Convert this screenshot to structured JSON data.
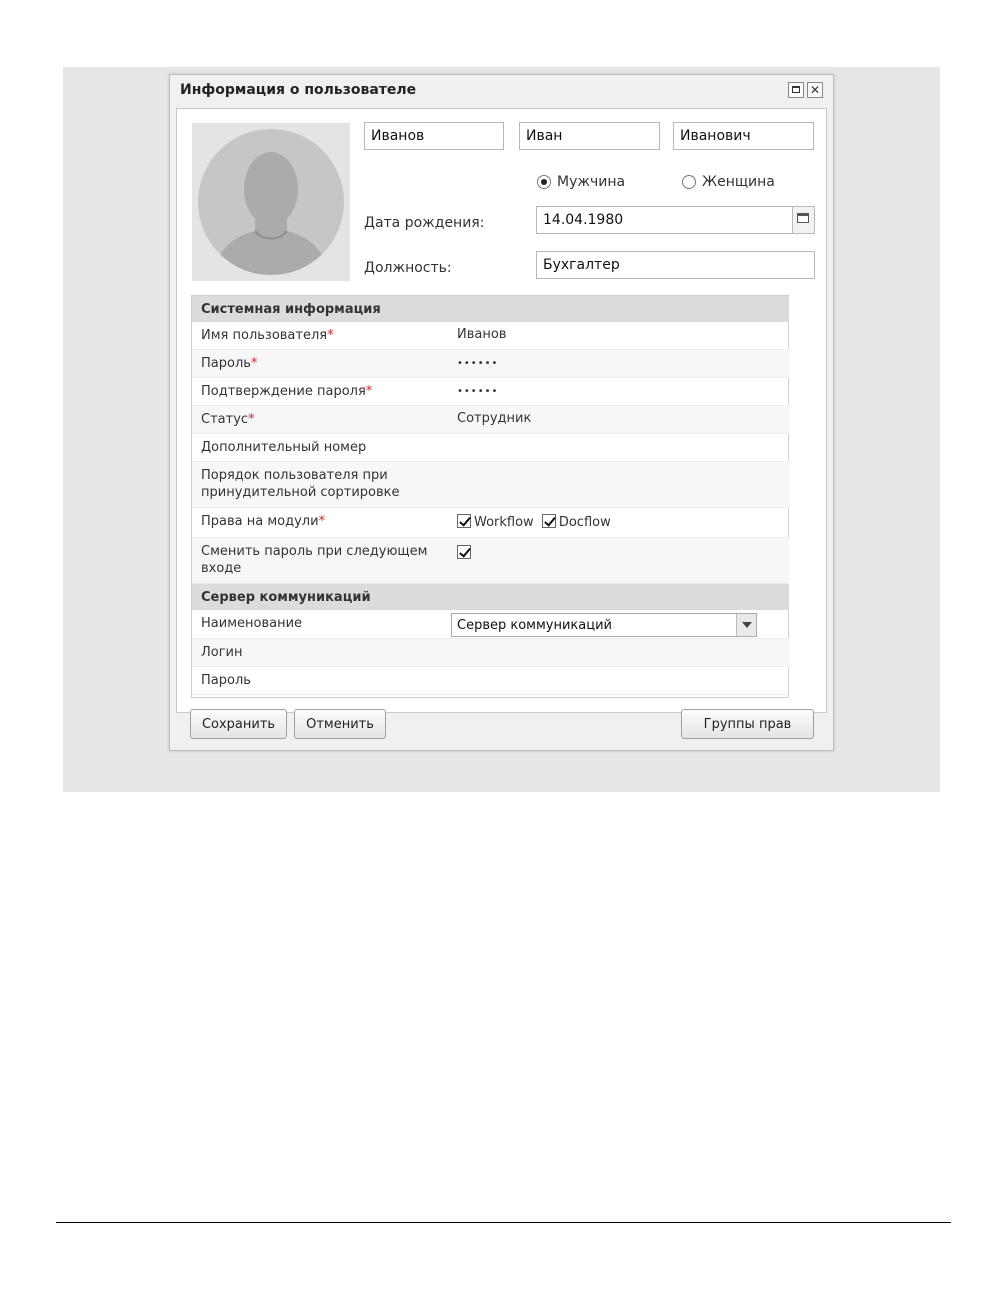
{
  "dialog": {
    "title": "Информация о пользователе",
    "maximize_icon": "maximize-icon",
    "close_icon": "close-icon"
  },
  "profile": {
    "last_name": "Иванов",
    "first_name": "Иван",
    "middle_name": "Иванович",
    "gender_options": [
      {
        "label": "Мужчина",
        "selected": true
      },
      {
        "label": "Женщина",
        "selected": false
      }
    ],
    "birth_date_label": "Дата рождения:",
    "birth_date": "14.04.1980",
    "position_label": "Должность:",
    "position": "Бухгалтер"
  },
  "system_info": {
    "header": "Системная информация",
    "username_label": "Имя пользователя",
    "username": "Иванов",
    "password_label": "Пароль",
    "password": "••••••",
    "confirm_label": "Подтверждение пароля",
    "confirm": "••••••",
    "status_label": "Статус",
    "status": "Сотрудник",
    "extra_number_label": "Дополнительный номер",
    "sort_order_label": "Порядок пользователя при принудительной сортировке",
    "modules_label": "Права на модули",
    "modules": [
      {
        "label": "Workflow",
        "checked": true
      },
      {
        "label": "Docflow",
        "checked": true
      }
    ],
    "change_password_label": "Сменить пароль при следующем входе",
    "change_password_checked": true,
    "required_mark": "*"
  },
  "comm_server": {
    "header": "Сервер коммуникаций",
    "name_label": "Наименование",
    "name_value": "Сервер коммуникаций",
    "login_label": "Логин",
    "password_label": "Пароль"
  },
  "buttons": {
    "save": "Сохранить",
    "cancel": "Отменить",
    "rights_groups": "Группы прав"
  },
  "colors": {
    "required": "#e02020",
    "section_bg": "#dcdcdc",
    "backdrop": "#e6e6e6"
  }
}
